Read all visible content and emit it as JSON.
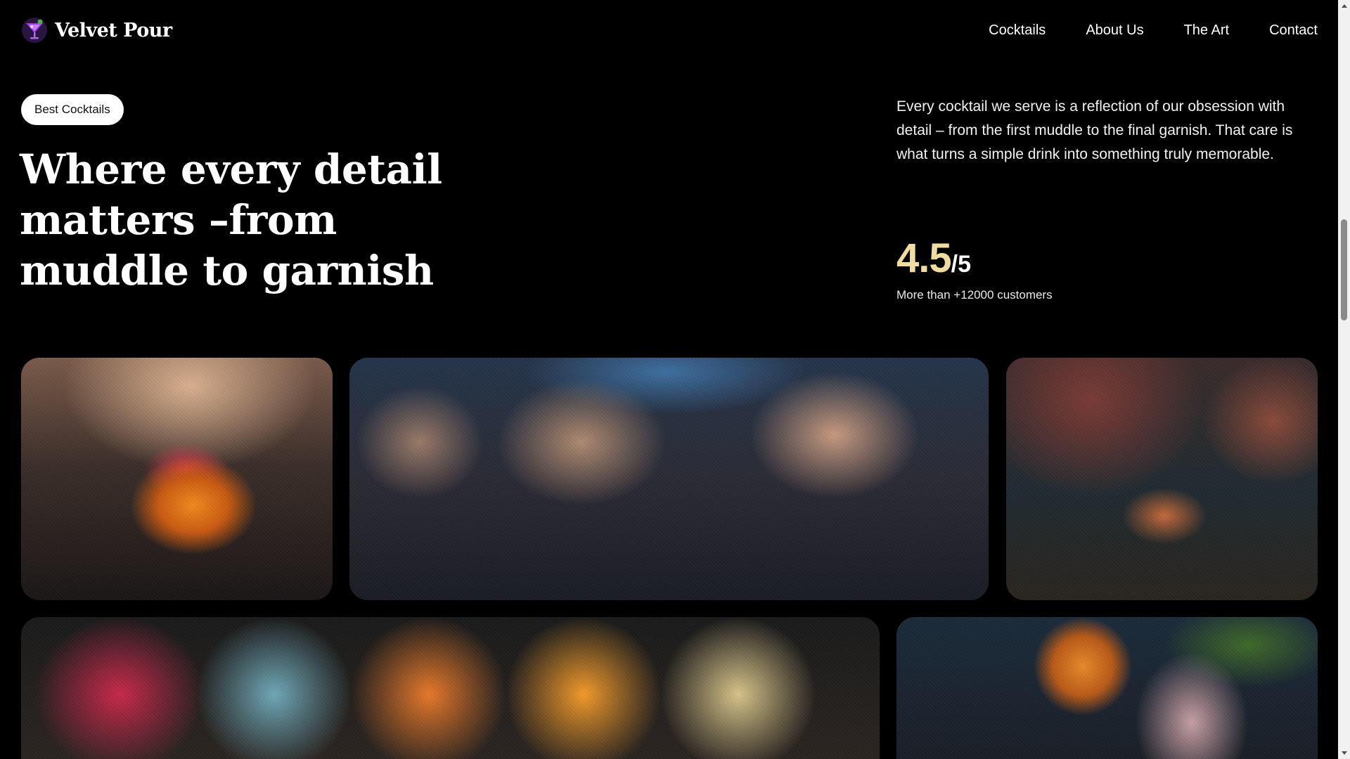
{
  "brand": {
    "name": "Velvet Pour",
    "logo_icon": "cocktail-glass-icon",
    "logo_colors": [
      "#7b2fbe",
      "#4caf50"
    ]
  },
  "nav": {
    "links": [
      "Cocktails",
      "About Us",
      "The Art",
      "Contact"
    ]
  },
  "hero": {
    "pill_label": "Best Cocktails",
    "headline": "Where every detail matters –from muddle to garnish",
    "description": "Every cocktail we serve is a reflection of our obsession with detail – from the first muddle to the final garnish. That care is what turns a simple drink into something truly memorable.",
    "rating": {
      "value": "4.5",
      "total": "/5",
      "caption": "More than +12000 customers",
      "accent_color": "#f1dca0"
    }
  },
  "gallery": {
    "images": [
      "bartender garnishing an orange cocktail",
      "friends toasting with drinks at a bar",
      "bartender straining a cocktail into a martini glass",
      "row of colorful cocktails in glasses",
      "cocktail with orange slice and flowers"
    ]
  },
  "colors": {
    "background": "#000000",
    "text": "#ffffff",
    "pill_bg": "#ffffff"
  }
}
